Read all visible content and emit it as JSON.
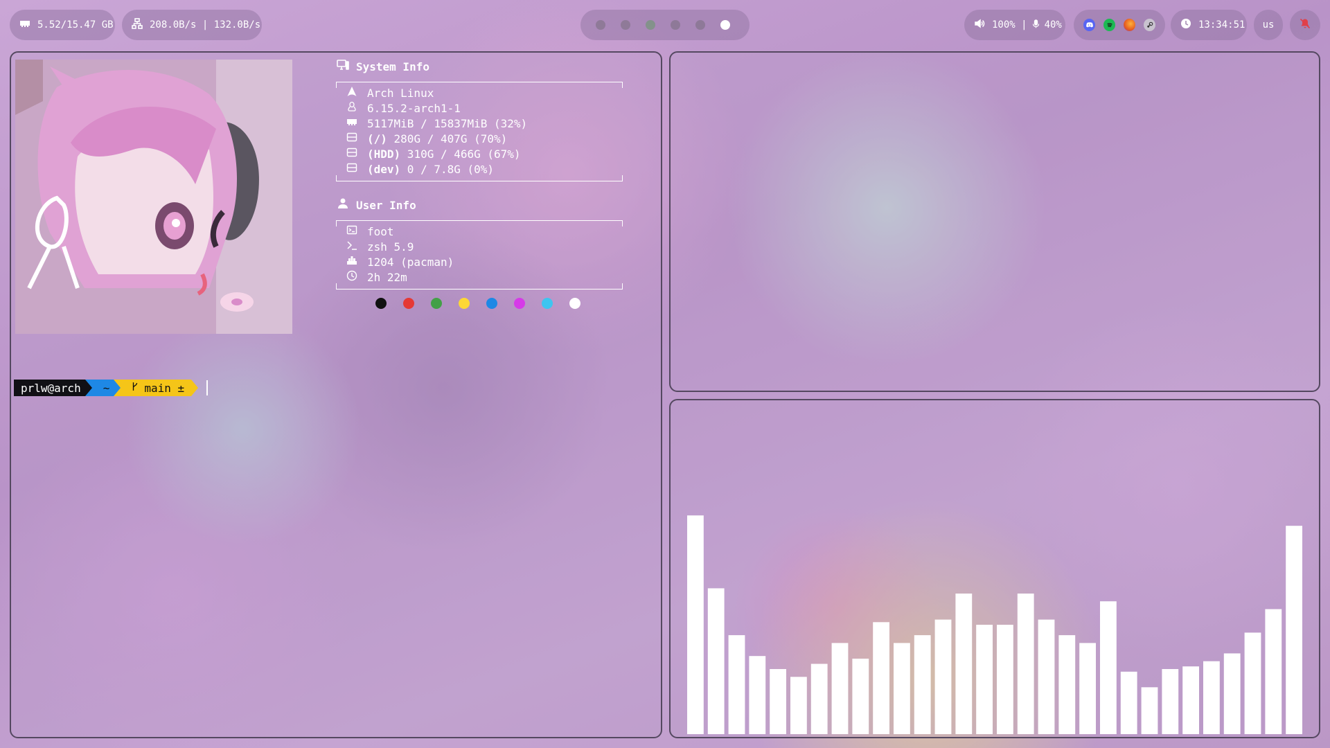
{
  "bar": {
    "memory": "5.52/15.47 GB",
    "network": "208.0B/s | 132.0B/s",
    "workspaces": [
      {
        "state": "empty"
      },
      {
        "state": "empty"
      },
      {
        "state": "occupied"
      },
      {
        "state": "empty"
      },
      {
        "state": "empty"
      },
      {
        "state": "active"
      }
    ],
    "audio": "100% | ",
    "mic": "40%",
    "tray": [
      "discord-icon",
      "spotify-icon",
      "firefox-icon",
      "steam-icon"
    ],
    "clock": "13:34:51",
    "keyboard_layout": "us",
    "notification_icon": "bell-off-icon"
  },
  "fetch": {
    "system_title": "System Info",
    "system_rows": [
      {
        "icon": "arch-icon",
        "key": "",
        "value": "Arch Linux"
      },
      {
        "icon": "linux-icon",
        "key": "",
        "value": "6.15.2-arch1-1"
      },
      {
        "icon": "memory-icon",
        "key": "",
        "value": "5117MiB / 15837MiB (32%)"
      },
      {
        "icon": "disk-icon",
        "key": "(/)",
        "value": " 280G / 407G (70%)"
      },
      {
        "icon": "disk-icon",
        "key": "(HDD)",
        "value": " 310G / 466G (67%)"
      },
      {
        "icon": "disk-icon",
        "key": "(dev)",
        "value": " 0 / 7.8G (0%)"
      }
    ],
    "user_title": "User Info",
    "user_rows": [
      {
        "icon": "terminal-icon",
        "value": "foot"
      },
      {
        "icon": "shell-icon",
        "value": "zsh 5.9"
      },
      {
        "icon": "package-icon",
        "value": "1204 (pacman)"
      },
      {
        "icon": "clock-icon",
        "value": "2h 22m"
      }
    ],
    "palette": [
      "#111111",
      "#e53935",
      "#43a047",
      "#fdd835",
      "#1e88e5",
      "#d63ae8",
      "#3ec5f0",
      "#ffffff"
    ]
  },
  "prompt": {
    "user": "prlw@arch",
    "dir": "~",
    "branch": "main ±"
  },
  "colors": {
    "panel_border": "#544860",
    "pipe_black": "#111111",
    "pipe_red": "#e53935",
    "pipe_green": "#43a047",
    "pipe_yellow": "#fdd835",
    "pipe_blue": "#1e88e5",
    "pipe_magenta": "#d63ae8",
    "pipe_cyan": "#3ec5f0",
    "pipe_white": "#ffffff"
  },
  "cava": {
    "levels": [
      0.84,
      0.56,
      0.38,
      0.3,
      0.25,
      0.22,
      0.27,
      0.35,
      0.29,
      0.43,
      0.35,
      0.38,
      0.44,
      0.54,
      0.42,
      0.42,
      0.54,
      0.44,
      0.38,
      0.35,
      0.51,
      0.24,
      0.18,
      0.25,
      0.26,
      0.28,
      0.31,
      0.39,
      0.48,
      0.8
    ]
  }
}
